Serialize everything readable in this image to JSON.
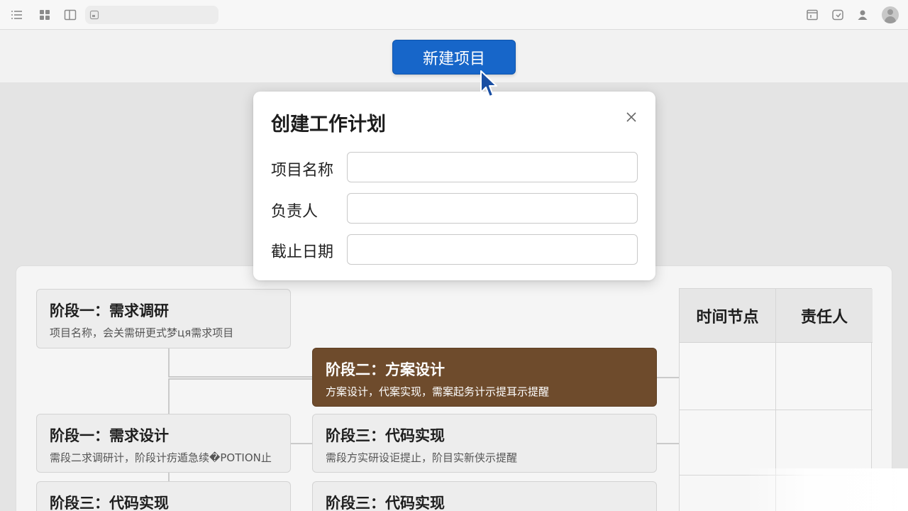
{
  "toolbar": {
    "left_icons": [
      "list-icon",
      "grid-icon",
      "panel-icon",
      "tab-icon"
    ],
    "right_icons": [
      "window-icon",
      "share-icon",
      "user-icon"
    ],
    "avatar": "avatar-icon"
  },
  "header": {
    "new_project_label": "新建项目"
  },
  "modal": {
    "title": "创建工作计划",
    "fields": [
      {
        "label": "项目名称",
        "value": "",
        "placeholder": ""
      },
      {
        "label": "负责人",
        "value": "",
        "placeholder": ""
      },
      {
        "label": "截止日期",
        "value": "",
        "placeholder": ""
      }
    ],
    "close_icon": "close-icon"
  },
  "stages": [
    {
      "title": "阶段一：需求调研",
      "subtitle": "项目名称，会关需研更式梦ця需求项目",
      "active": false
    },
    {
      "title": "阶段二：方案设计",
      "subtitle": "方案设计，代案实现，需案起务计示提耳示提醒",
      "active": true
    },
    {
      "title": "阶段一：需求设计",
      "subtitle": "需段二求调研计，阶段计疠遁急续�POTION止",
      "active": false
    },
    {
      "title": "阶段三：代码实现",
      "subtitle": "需段方实研设讵提止，阶目实新侠示提醒",
      "active": false
    },
    {
      "title": "阶段三：代码实现",
      "subtitle": "",
      "active": false
    },
    {
      "title": "阶段三：代码实现",
      "subtitle": "",
      "active": false
    }
  ],
  "schedule_table": {
    "headers": [
      "时间节点",
      "责任人"
    ]
  },
  "colors": {
    "primary_button": "#1766c9",
    "active_stage": "#6e4b2c"
  }
}
